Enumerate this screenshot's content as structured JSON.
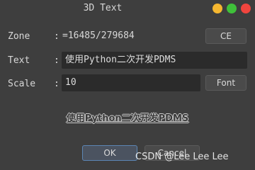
{
  "window": {
    "title": "3D Text"
  },
  "form": {
    "zone": {
      "label": "Zone",
      "colon": ":",
      "value": "=16485/279684",
      "button": "CE"
    },
    "text": {
      "label": "Text",
      "colon": ":",
      "value": "使用Python二次开发PDMS"
    },
    "scale": {
      "label": "Scale",
      "colon": ":",
      "value": "10",
      "button": "Font"
    }
  },
  "preview": {
    "text": "使用Python二次开发PDMS"
  },
  "buttons": {
    "ok": "OK",
    "cancel": "Cancel"
  },
  "watermark": "CSDN @Lee Lee Lee",
  "colors": {
    "window_bg": "#3e3e3e",
    "field_bg": "#2b2b2b",
    "ok_border": "#5c86b4",
    "close": "#f0453e",
    "maximize": "#3fc13a",
    "minimize": "#f5b730"
  }
}
